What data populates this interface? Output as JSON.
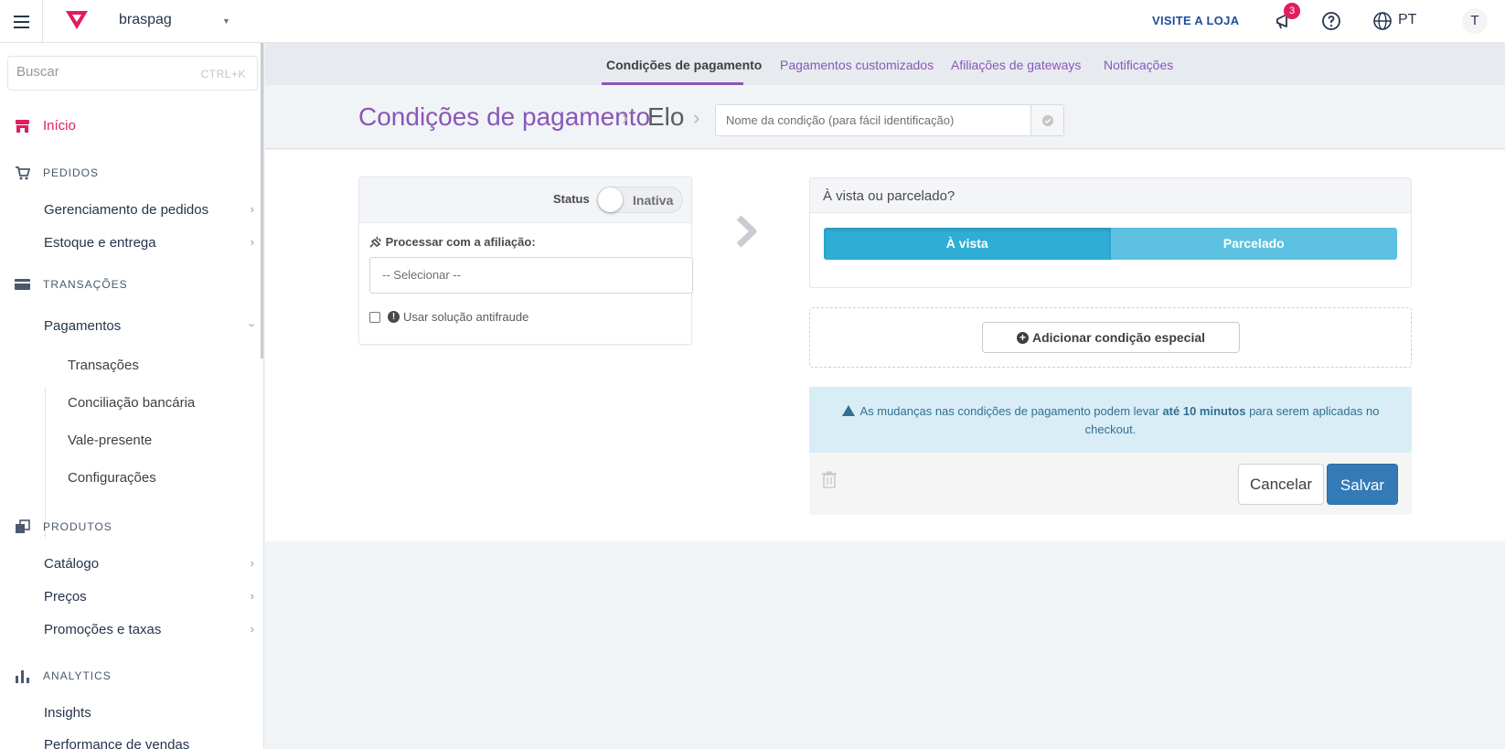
{
  "topbar": {
    "account": "braspag",
    "visit_store": "VISITE A LOJA",
    "notification_count": "3",
    "language": "PT",
    "avatar_initial": "T"
  },
  "sidebar": {
    "search_placeholder": "Buscar",
    "search_shortcut": "CTRL+K",
    "home": "Início",
    "sections": {
      "pedidos": "PEDIDOS",
      "transacoes": "TRANSAÇÕES",
      "produtos": "PRODUTOS",
      "analytics": "ANALYTICS"
    },
    "items": {
      "gerenciamento": "Gerenciamento de pedidos",
      "estoque": "Estoque e entrega",
      "pagamentos": "Pagamentos",
      "transacoes": "Transações",
      "conciliacao": "Conciliação bancária",
      "vale": "Vale-presente",
      "configuracoes": "Configurações",
      "catalogo": "Catálogo",
      "precos": "Preços",
      "promocoes": "Promoções e taxas",
      "insights": "Insights",
      "performance": "Performance de vendas"
    }
  },
  "tabs": {
    "condicoes": "Condições de pagamento",
    "customizados": "Pagamentos customizados",
    "afiliacoes": "Afiliações de gateways",
    "notificacoes": "Notificações"
  },
  "breadcrumb": {
    "parent": "Condições de pagamento",
    "current": "Elo"
  },
  "condition_name_placeholder": "Nome da condição (para fácil identificação)",
  "left_card": {
    "status_label": "Status",
    "status_value": "Inativa",
    "affiliation_label": "Processar com a afiliação:",
    "affiliation_selected": "-- Selecionar --",
    "antifraud_label": "Usar solução antifraude"
  },
  "right_card": {
    "title": "À vista ou parcelado?",
    "option_cash": "À vista",
    "option_installments": "Parcelado"
  },
  "special_condition_button": "Adicionar condição especial",
  "alert": {
    "text_before": "As mudanças nas condições de pagamento podem levar ",
    "text_bold": "até 10 minutos",
    "text_after": " para serem aplicadas no checkout."
  },
  "actions": {
    "cancel": "Cancelar",
    "save": "Salvar"
  },
  "colors": {
    "brand_pink": "#e11d5c",
    "purple": "#8a56b8",
    "primary_blue": "#337ab7",
    "cyan": "#2fadd5"
  }
}
